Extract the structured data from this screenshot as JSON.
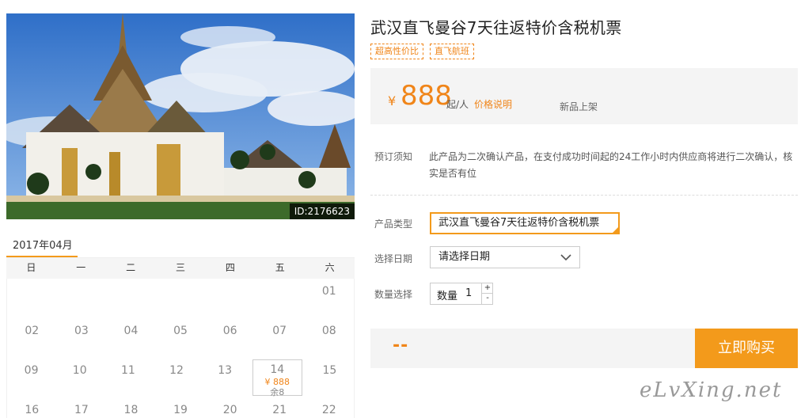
{
  "photo": {
    "id_label": "ID:2176623"
  },
  "calendar": {
    "month": "2017年04月",
    "weekdays": [
      "日",
      "一",
      "二",
      "三",
      "四",
      "五",
      "六"
    ],
    "rows": [
      [
        "",
        "",
        "",
        "",
        "",
        "",
        "01"
      ],
      [
        "02",
        "03",
        "04",
        "05",
        "06",
        "07",
        "08"
      ],
      [
        "09",
        "10",
        "11",
        "12",
        "13",
        "14",
        "15"
      ],
      [
        "16",
        "17",
        "18",
        "19",
        "20",
        "21",
        "22"
      ]
    ],
    "active_day": {
      "day": "14",
      "price": "¥ 888",
      "stock": "余8"
    }
  },
  "product": {
    "title": "武汉直飞曼谷7天往返特价含税机票",
    "tags": [
      "超高性价比",
      "直飞航班"
    ]
  },
  "price": {
    "currency": "¥",
    "value": "888",
    "unit": "起/人",
    "link": "价格说明",
    "new_tag": "新品上架"
  },
  "notice": {
    "label": "预订须知",
    "text": "此产品为二次确认产品，在支付成功时间起的24工作小时内供应商将进行二次确认，核实是否有位"
  },
  "form": {
    "type_label": "产品类型",
    "type_value": "武汉直飞曼谷7天往返特价含税机票",
    "date_label": "选择日期",
    "date_value": "请选择日期",
    "qty_label": "数量选择",
    "qty_text": "数量",
    "qty_value": "1",
    "plus": "+",
    "minus": "-"
  },
  "buy": {
    "total": "--",
    "button": "立即购买"
  },
  "watermark": "eLvXing.net",
  "colors": {
    "accent": "#f39a1b",
    "price": "#f08519"
  }
}
